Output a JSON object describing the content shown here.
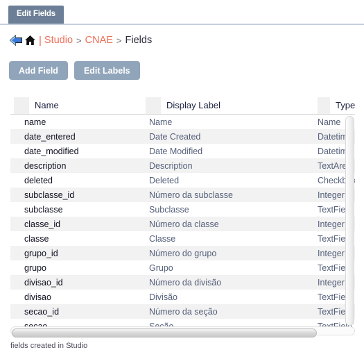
{
  "tab": {
    "label": "Edit Fields"
  },
  "breadcrumb": {
    "back_icon": "back-arrow-icon",
    "home_icon": "home-icon",
    "pipe": "|",
    "separator": ">",
    "items": [
      {
        "label": "Studio",
        "type": "link"
      },
      {
        "label": "CNAE",
        "type": "link"
      },
      {
        "label": "Fields",
        "type": "current"
      }
    ]
  },
  "toolbar": {
    "add_field_label": "Add Field",
    "edit_labels_label": "Edit Labels"
  },
  "grid": {
    "columns": [
      {
        "key": "name",
        "label": "Name"
      },
      {
        "key": "display_label",
        "label": "Display Label"
      },
      {
        "key": "type",
        "label": "Type"
      }
    ],
    "rows": [
      {
        "name": "name",
        "display_label": "Name",
        "type": "Name"
      },
      {
        "name": "date_entered",
        "display_label": "Date Created",
        "type": "Datetime"
      },
      {
        "name": "date_modified",
        "display_label": "Date Modified",
        "type": "Datetime"
      },
      {
        "name": "description",
        "display_label": "Description",
        "type": "TextArea"
      },
      {
        "name": "deleted",
        "display_label": "Deleted",
        "type": "Checkbox"
      },
      {
        "name": "subclasse_id",
        "display_label": "Número da subclasse",
        "type": "Integer"
      },
      {
        "name": "subclasse",
        "display_label": "Subclasse",
        "type": "TextField"
      },
      {
        "name": "classe_id",
        "display_label": "Número da classe",
        "type": "Integer"
      },
      {
        "name": "classe",
        "display_label": "Classe",
        "type": "TextField"
      },
      {
        "name": "grupo_id",
        "display_label": "Número do grupo",
        "type": "Integer"
      },
      {
        "name": "grupo",
        "display_label": "Grupo",
        "type": "TextField"
      },
      {
        "name": "divisao_id",
        "display_label": "Número da divisão",
        "type": "Integer"
      },
      {
        "name": "divisao",
        "display_label": "Divisão",
        "type": "TextField"
      },
      {
        "name": "secao_id",
        "display_label": "Número da seção",
        "type": "TextField"
      },
      {
        "name": "secao",
        "display_label": "Seção",
        "type": "TextField"
      }
    ]
  },
  "footer": {
    "text": "fields created in Studio"
  },
  "colors": {
    "tab_bg": "#6c7f96",
    "button_bg": "#90a4ba",
    "link": "#ef6d57",
    "row_alt": "#f2f2f2",
    "cell_muted": "#55607a"
  }
}
